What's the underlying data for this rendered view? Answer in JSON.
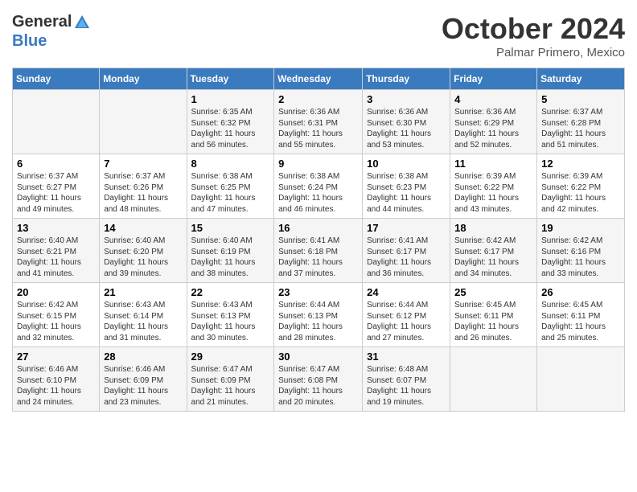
{
  "header": {
    "logo_line1": "General",
    "logo_line2": "Blue",
    "month": "October 2024",
    "location": "Palmar Primero, Mexico"
  },
  "days_of_week": [
    "Sunday",
    "Monday",
    "Tuesday",
    "Wednesday",
    "Thursday",
    "Friday",
    "Saturday"
  ],
  "weeks": [
    [
      {
        "day": "",
        "sunrise": "",
        "sunset": "",
        "daylight": ""
      },
      {
        "day": "",
        "sunrise": "",
        "sunset": "",
        "daylight": ""
      },
      {
        "day": "1",
        "sunrise": "Sunrise: 6:35 AM",
        "sunset": "Sunset: 6:32 PM",
        "daylight": "Daylight: 11 hours and 56 minutes."
      },
      {
        "day": "2",
        "sunrise": "Sunrise: 6:36 AM",
        "sunset": "Sunset: 6:31 PM",
        "daylight": "Daylight: 11 hours and 55 minutes."
      },
      {
        "day": "3",
        "sunrise": "Sunrise: 6:36 AM",
        "sunset": "Sunset: 6:30 PM",
        "daylight": "Daylight: 11 hours and 53 minutes."
      },
      {
        "day": "4",
        "sunrise": "Sunrise: 6:36 AM",
        "sunset": "Sunset: 6:29 PM",
        "daylight": "Daylight: 11 hours and 52 minutes."
      },
      {
        "day": "5",
        "sunrise": "Sunrise: 6:37 AM",
        "sunset": "Sunset: 6:28 PM",
        "daylight": "Daylight: 11 hours and 51 minutes."
      }
    ],
    [
      {
        "day": "6",
        "sunrise": "Sunrise: 6:37 AM",
        "sunset": "Sunset: 6:27 PM",
        "daylight": "Daylight: 11 hours and 49 minutes."
      },
      {
        "day": "7",
        "sunrise": "Sunrise: 6:37 AM",
        "sunset": "Sunset: 6:26 PM",
        "daylight": "Daylight: 11 hours and 48 minutes."
      },
      {
        "day": "8",
        "sunrise": "Sunrise: 6:38 AM",
        "sunset": "Sunset: 6:25 PM",
        "daylight": "Daylight: 11 hours and 47 minutes."
      },
      {
        "day": "9",
        "sunrise": "Sunrise: 6:38 AM",
        "sunset": "Sunset: 6:24 PM",
        "daylight": "Daylight: 11 hours and 46 minutes."
      },
      {
        "day": "10",
        "sunrise": "Sunrise: 6:38 AM",
        "sunset": "Sunset: 6:23 PM",
        "daylight": "Daylight: 11 hours and 44 minutes."
      },
      {
        "day": "11",
        "sunrise": "Sunrise: 6:39 AM",
        "sunset": "Sunset: 6:22 PM",
        "daylight": "Daylight: 11 hours and 43 minutes."
      },
      {
        "day": "12",
        "sunrise": "Sunrise: 6:39 AM",
        "sunset": "Sunset: 6:22 PM",
        "daylight": "Daylight: 11 hours and 42 minutes."
      }
    ],
    [
      {
        "day": "13",
        "sunrise": "Sunrise: 6:40 AM",
        "sunset": "Sunset: 6:21 PM",
        "daylight": "Daylight: 11 hours and 41 minutes."
      },
      {
        "day": "14",
        "sunrise": "Sunrise: 6:40 AM",
        "sunset": "Sunset: 6:20 PM",
        "daylight": "Daylight: 11 hours and 39 minutes."
      },
      {
        "day": "15",
        "sunrise": "Sunrise: 6:40 AM",
        "sunset": "Sunset: 6:19 PM",
        "daylight": "Daylight: 11 hours and 38 minutes."
      },
      {
        "day": "16",
        "sunrise": "Sunrise: 6:41 AM",
        "sunset": "Sunset: 6:18 PM",
        "daylight": "Daylight: 11 hours and 37 minutes."
      },
      {
        "day": "17",
        "sunrise": "Sunrise: 6:41 AM",
        "sunset": "Sunset: 6:17 PM",
        "daylight": "Daylight: 11 hours and 36 minutes."
      },
      {
        "day": "18",
        "sunrise": "Sunrise: 6:42 AM",
        "sunset": "Sunset: 6:17 PM",
        "daylight": "Daylight: 11 hours and 34 minutes."
      },
      {
        "day": "19",
        "sunrise": "Sunrise: 6:42 AM",
        "sunset": "Sunset: 6:16 PM",
        "daylight": "Daylight: 11 hours and 33 minutes."
      }
    ],
    [
      {
        "day": "20",
        "sunrise": "Sunrise: 6:42 AM",
        "sunset": "Sunset: 6:15 PM",
        "daylight": "Daylight: 11 hours and 32 minutes."
      },
      {
        "day": "21",
        "sunrise": "Sunrise: 6:43 AM",
        "sunset": "Sunset: 6:14 PM",
        "daylight": "Daylight: 11 hours and 31 minutes."
      },
      {
        "day": "22",
        "sunrise": "Sunrise: 6:43 AM",
        "sunset": "Sunset: 6:13 PM",
        "daylight": "Daylight: 11 hours and 30 minutes."
      },
      {
        "day": "23",
        "sunrise": "Sunrise: 6:44 AM",
        "sunset": "Sunset: 6:13 PM",
        "daylight": "Daylight: 11 hours and 28 minutes."
      },
      {
        "day": "24",
        "sunrise": "Sunrise: 6:44 AM",
        "sunset": "Sunset: 6:12 PM",
        "daylight": "Daylight: 11 hours and 27 minutes."
      },
      {
        "day": "25",
        "sunrise": "Sunrise: 6:45 AM",
        "sunset": "Sunset: 6:11 PM",
        "daylight": "Daylight: 11 hours and 26 minutes."
      },
      {
        "day": "26",
        "sunrise": "Sunrise: 6:45 AM",
        "sunset": "Sunset: 6:11 PM",
        "daylight": "Daylight: 11 hours and 25 minutes."
      }
    ],
    [
      {
        "day": "27",
        "sunrise": "Sunrise: 6:46 AM",
        "sunset": "Sunset: 6:10 PM",
        "daylight": "Daylight: 11 hours and 24 minutes."
      },
      {
        "day": "28",
        "sunrise": "Sunrise: 6:46 AM",
        "sunset": "Sunset: 6:09 PM",
        "daylight": "Daylight: 11 hours and 23 minutes."
      },
      {
        "day": "29",
        "sunrise": "Sunrise: 6:47 AM",
        "sunset": "Sunset: 6:09 PM",
        "daylight": "Daylight: 11 hours and 21 minutes."
      },
      {
        "day": "30",
        "sunrise": "Sunrise: 6:47 AM",
        "sunset": "Sunset: 6:08 PM",
        "daylight": "Daylight: 11 hours and 20 minutes."
      },
      {
        "day": "31",
        "sunrise": "Sunrise: 6:48 AM",
        "sunset": "Sunset: 6:07 PM",
        "daylight": "Daylight: 11 hours and 19 minutes."
      },
      {
        "day": "",
        "sunrise": "",
        "sunset": "",
        "daylight": ""
      },
      {
        "day": "",
        "sunrise": "",
        "sunset": "",
        "daylight": ""
      }
    ]
  ]
}
